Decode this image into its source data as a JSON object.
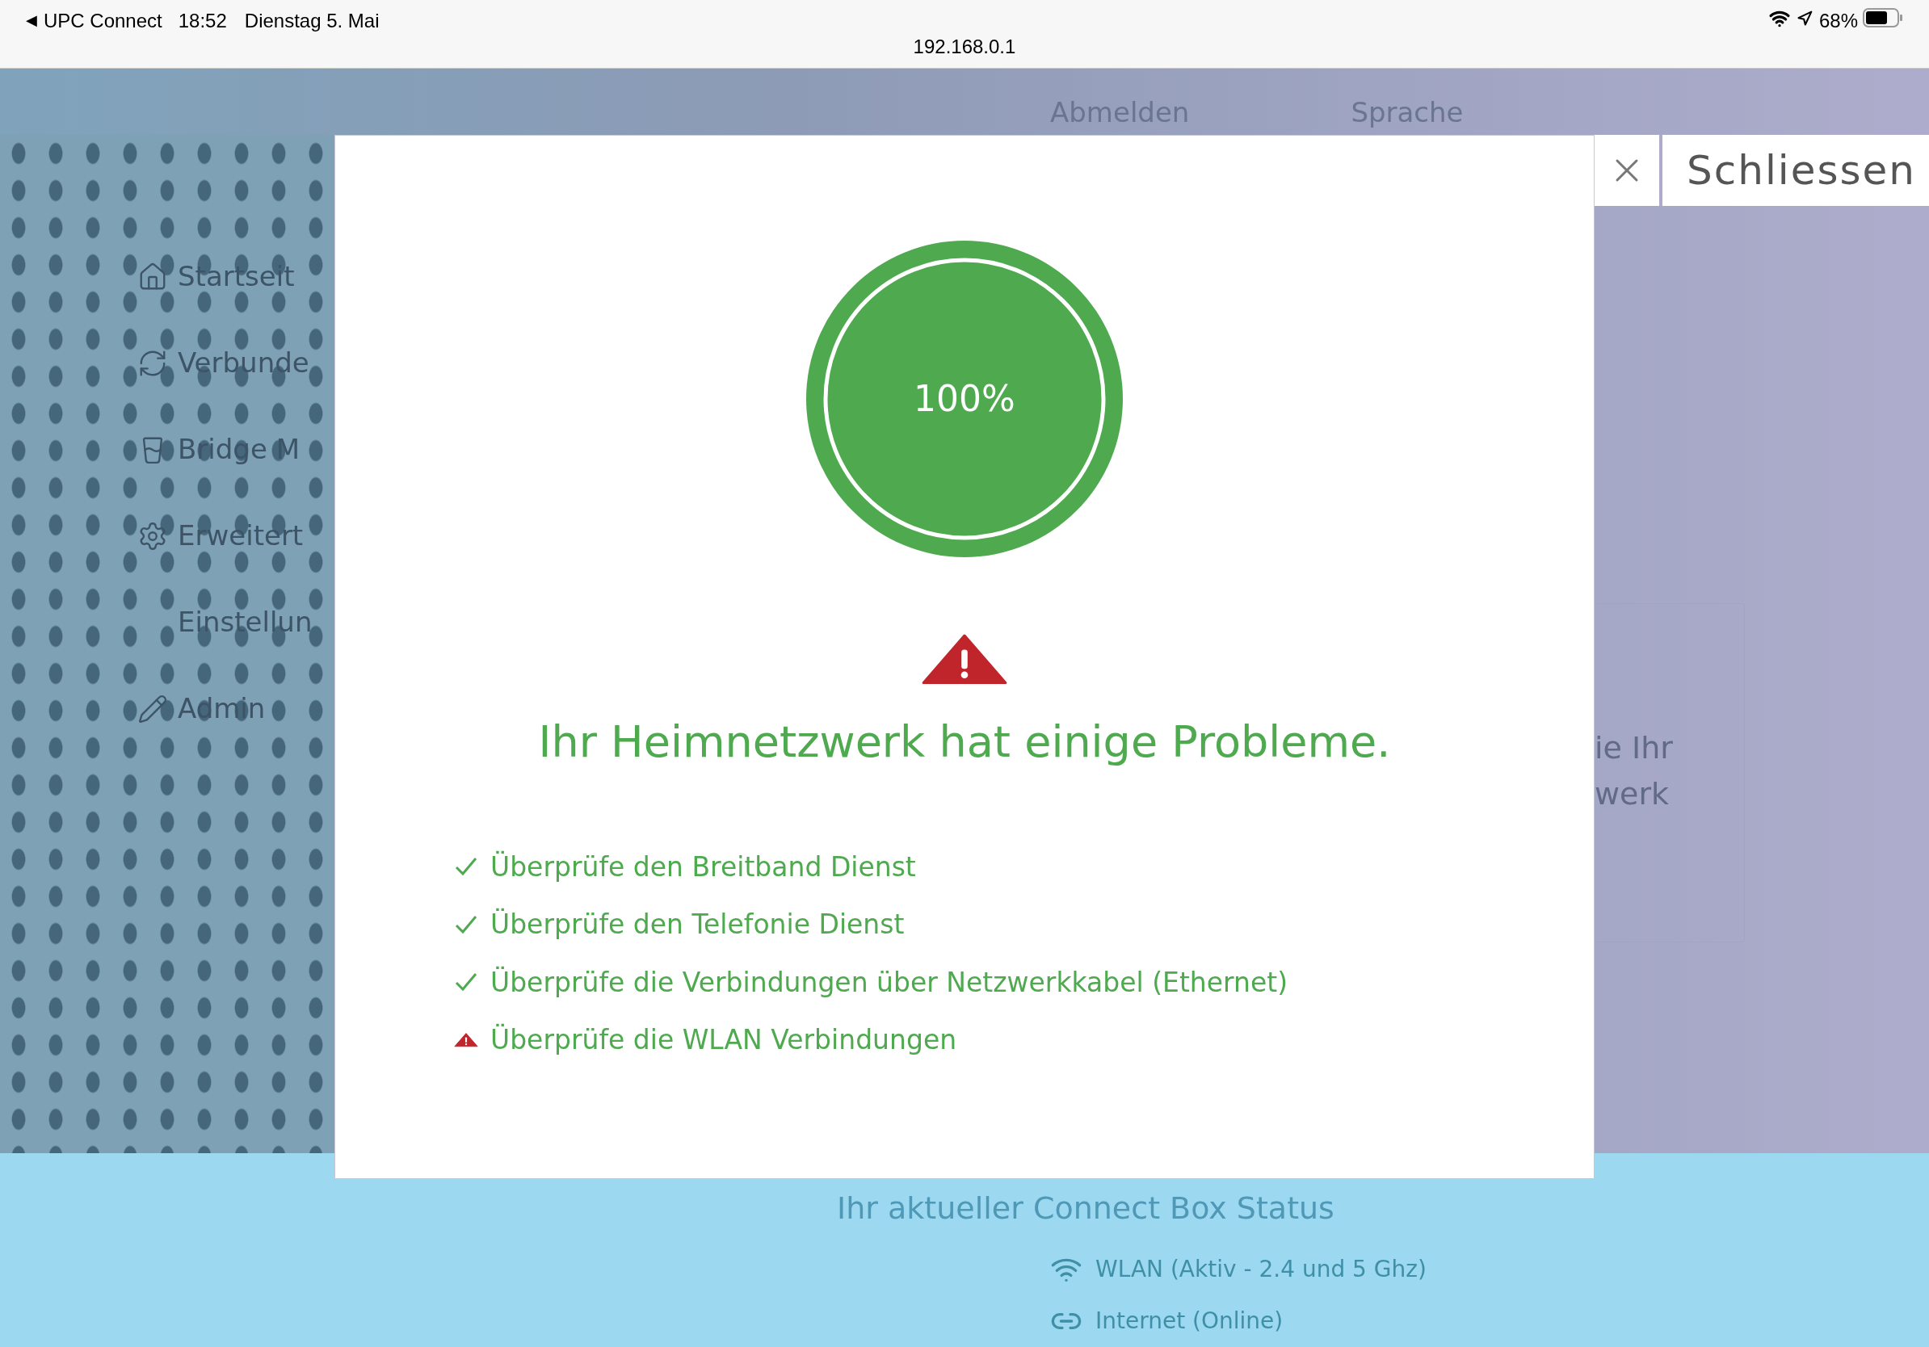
{
  "status_bar": {
    "back_arrow": "◀",
    "app": "UPC Connect",
    "time": "18:52",
    "date": "Dienstag 5. Mai",
    "url": "192.168.0.1",
    "battery": "68%"
  },
  "header": {
    "logout": "Abmelden",
    "language": "Sprache"
  },
  "sidebar": {
    "items": [
      {
        "label": "Startseit"
      },
      {
        "label": "Verbunde"
      },
      {
        "label": "Bridge M"
      },
      {
        "label": "Erweitert"
      },
      {
        "label": "Einstellun"
      },
      {
        "label": "Admin"
      }
    ]
  },
  "info_card": {
    "lines": [
      "ie Ihr",
      "werk"
    ]
  },
  "status_panel": {
    "title": "Ihr aktueller Connect Box Status",
    "items": [
      {
        "kind": "wlan",
        "label": "WLAN (Aktiv - 2.4 und 5 Ghz)"
      },
      {
        "kind": "internet",
        "label": "Internet (Online)"
      }
    ]
  },
  "dialog": {
    "close": "Schliessen",
    "progress": {
      "label": "100%",
      "level": 1
    },
    "heading": "Ihr Heimnetzwerk hat einige Probleme.",
    "checks": [
      {
        "kind": "ok",
        "label": "Überprüfe den Breitband Dienst"
      },
      {
        "kind": "ok",
        "label": "Überprüfe den Telefonie Dienst"
      },
      {
        "kind": "ok",
        "label": "Überprüfe die Verbindungen über Netzwerkkabel (Ethernet)"
      },
      {
        "kind": "warning",
        "label": "Überprüfe die WLAN Verbindungen"
      }
    ]
  }
}
